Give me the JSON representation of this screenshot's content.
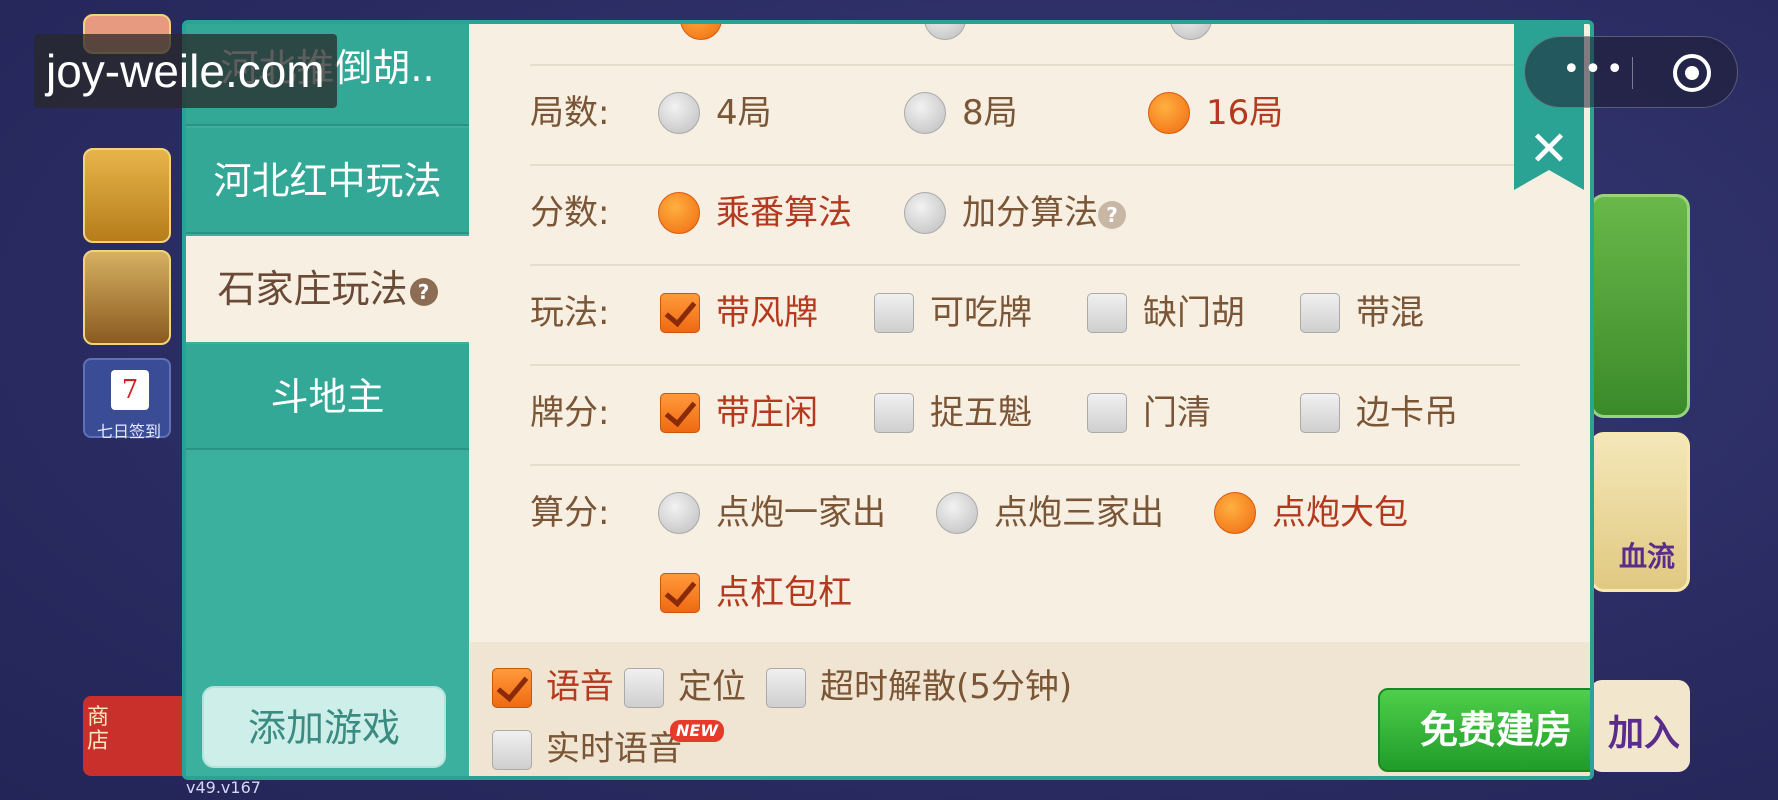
{
  "watermark": "joy-weile.com",
  "background": {
    "calendar_label": "七日签到",
    "calendar_num": "7",
    "shop_label": "商店",
    "right_card2_label": "血流",
    "join_label": "加入",
    "version": "v49.v167"
  },
  "capsule": {
    "more_icon": "more-dots-icon",
    "close_icon": "target-icon"
  },
  "sidebar": {
    "tabs": [
      {
        "label": "河北推倒胡.."
      },
      {
        "label": "河北红中玩法"
      },
      {
        "label": "石家庄玩法"
      },
      {
        "label": "斗地主"
      }
    ],
    "active_tab_help": "?",
    "add_game_label": "添加游戏"
  },
  "rules": {
    "rounds": {
      "label": "局数:",
      "options": [
        "4局",
        "8局",
        "16局"
      ],
      "selected": "16局"
    },
    "score": {
      "label": "分数:",
      "options": [
        "乘番算法",
        "加分算法"
      ],
      "selected": "乘番算法",
      "help": "?"
    },
    "play": {
      "label": "玩法:",
      "options": [
        "带风牌",
        "可吃牌",
        "缺门胡",
        "带混"
      ],
      "checked": [
        "带风牌"
      ]
    },
    "tile_score": {
      "label": "牌分:",
      "options": [
        "带庄闲",
        "捉五魁",
        "门清",
        "边卡吊"
      ],
      "checked": [
        "带庄闲"
      ]
    },
    "calc": {
      "label": "算分:",
      "options": [
        "点炮一家出",
        "点炮三家出",
        "点炮大包"
      ],
      "selected": "点炮大包",
      "extra_option": "点杠包杠",
      "extra_checked": true
    }
  },
  "bottom": {
    "voice": "语音",
    "location": "定位",
    "timeout": "超时解散(5分钟)",
    "realtime_voice": "实时语音",
    "new_badge": "NEW",
    "create_button": "免费建房"
  },
  "close_label": "✕",
  "colors": {
    "teal": "#2aa394",
    "orange": "#f06a10",
    "green": "#1f9c2a",
    "text_brown": "#7a5536",
    "text_red": "#b33a1e"
  }
}
